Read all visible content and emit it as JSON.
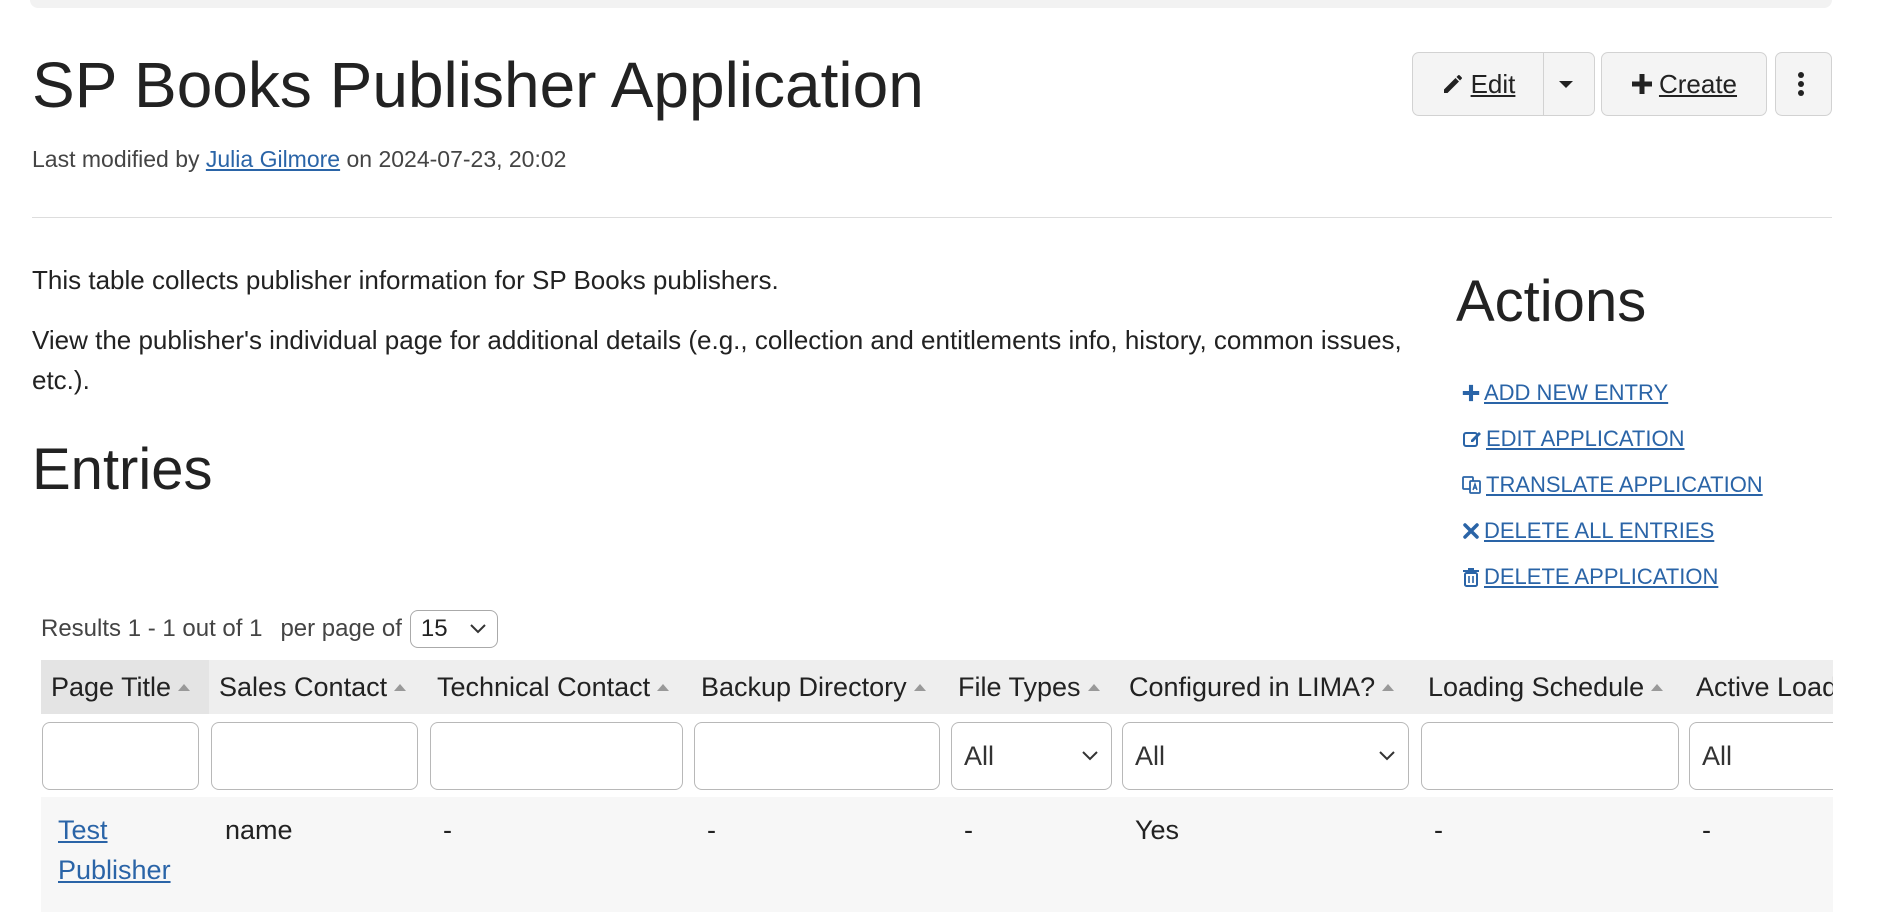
{
  "page": {
    "title": "SP Books Publisher Application",
    "modified_prefix": "Last modified by ",
    "modified_user": "Julia Gilmore",
    "modified_suffix": " on 2024-07-23, 20:02"
  },
  "toolbar": {
    "edit_label": "Edit",
    "create_label": "Create"
  },
  "description": {
    "line1": "This table collects publisher information for SP Books publishers.",
    "line2": "View the publisher's individual page for additional details (e.g., collection and entitlements info, history, common issues, etc.)."
  },
  "entries": {
    "title": "Entries",
    "results_text": "Results 1 - 1 out of 1",
    "per_page_label": "per page of",
    "per_page_value": "15"
  },
  "actions": {
    "title": "Actions",
    "items": [
      {
        "label": "ADD NEW ENTRY",
        "icon": "plus-icon"
      },
      {
        "label": "EDIT APPLICATION",
        "icon": "edit-icon"
      },
      {
        "label": "TRANSLATE APPLICATION",
        "icon": "translate-icon"
      },
      {
        "label": "DELETE ALL ENTRIES",
        "icon": "x-icon"
      },
      {
        "label": "DELETE APPLICATION",
        "icon": "trash-icon"
      }
    ]
  },
  "table": {
    "columns": [
      "Page Title",
      "Sales Contact",
      "Technical Contact",
      "Backup Directory",
      "File Types",
      "Configured in LIMA?",
      "Loading Schedule",
      "Active Loadin"
    ],
    "filters": [
      "",
      "",
      "",
      "",
      "All",
      "All",
      "",
      "All"
    ],
    "rows": [
      {
        "cells": [
          "Test Publisher",
          "name",
          "-",
          "-",
          "-",
          "Yes",
          "-",
          "-"
        ]
      }
    ]
  },
  "colors": {
    "link": "#2a64a7",
    "header_bg": "#eeeeee",
    "row_bg": "#f7f7f7",
    "button_bg": "#f4f4f4"
  }
}
